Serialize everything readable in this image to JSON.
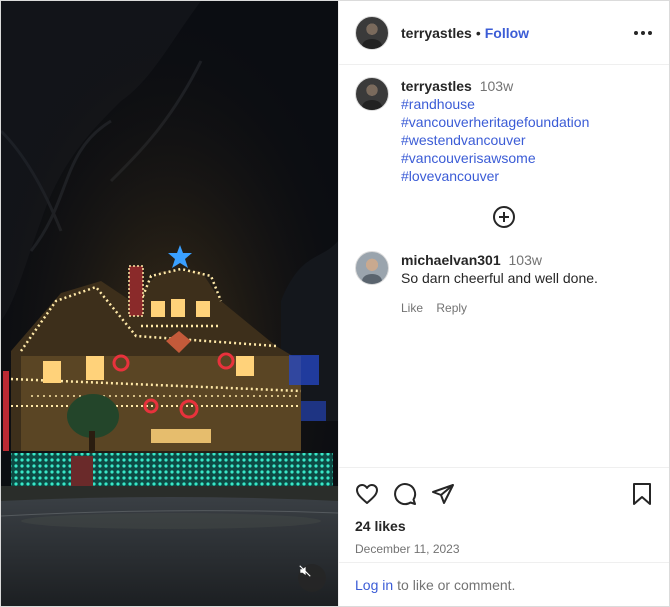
{
  "post": {
    "author": "terryastles",
    "separator": "•",
    "follow_label": "Follow",
    "caption": {
      "author": "terryastles",
      "age": "103w",
      "hashtags_lines": [
        "#randhouse",
        "#vancouverheritagefoundation"
      ],
      "hashtag_line3a": "#westendvancouver",
      "hashtag_line3b": "#vancouverisawsome",
      "hashtag_last": "#lovevancouver"
    },
    "comment": {
      "author": "michaelvan301",
      "age": "103w",
      "text": "So darn cheerful and well done.",
      "like_label": "Like",
      "reply_label": "Reply"
    },
    "likes": "24 likes",
    "date": "December 11, 2023",
    "login_link": "Log in",
    "login_suffix": "to like or comment."
  },
  "icons": {
    "more": "more-horizontal-icon",
    "add_comments": "plus-circle-icon",
    "like": "heart-icon",
    "comment": "comment-bubble-icon",
    "share": "paper-plane-icon",
    "save": "bookmark-icon",
    "mute": "speaker-muted-icon"
  },
  "colors": {
    "link": "#3b5cd6",
    "muted": "#737373",
    "lights_teal": "#25d6b5",
    "lights_warm": "#ffe9a8",
    "lights_red": "#e8323c"
  }
}
